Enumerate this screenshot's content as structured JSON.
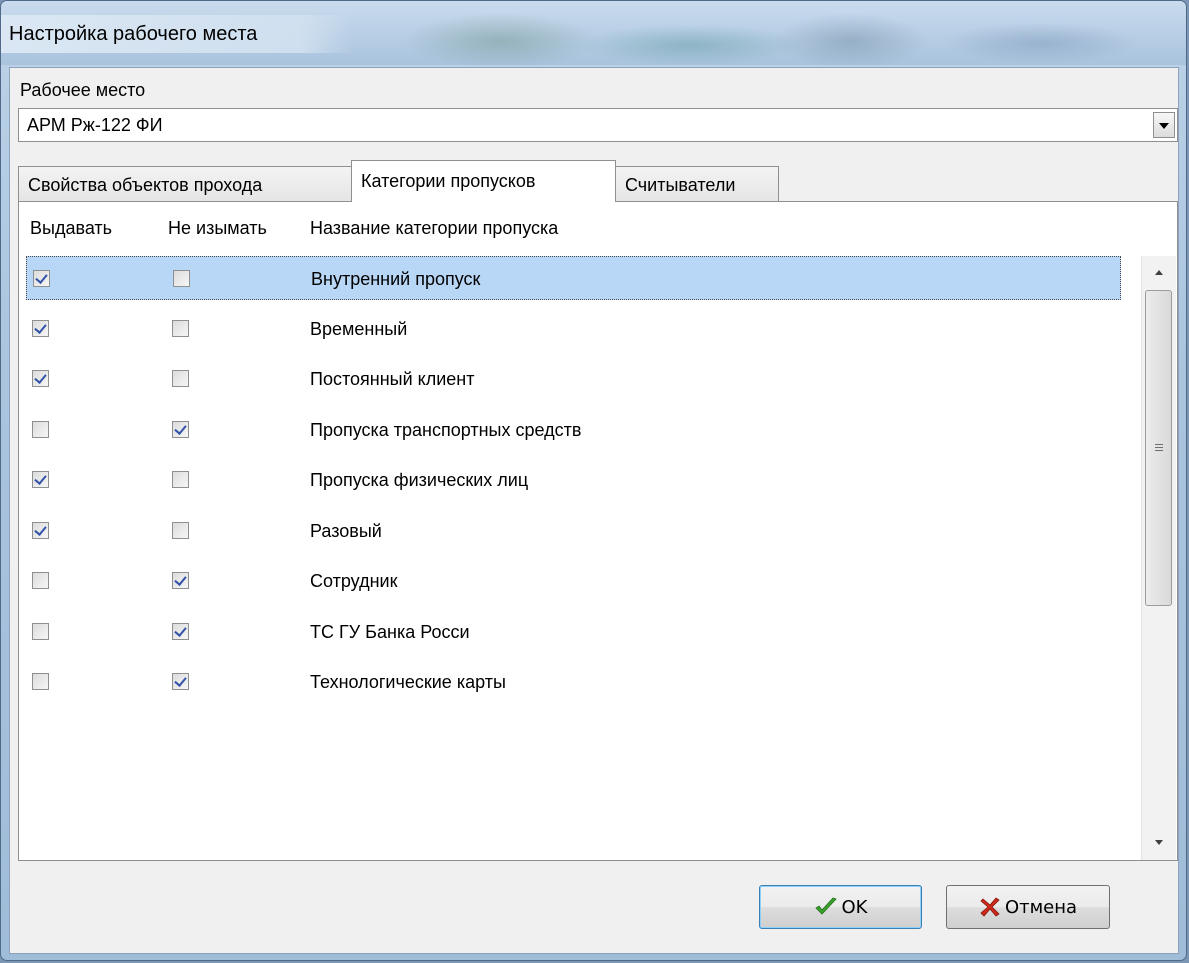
{
  "window": {
    "title": "Настройка рабочего места"
  },
  "workstation": {
    "label": "Рабочее место",
    "value": "АРМ Рж-122 ФИ"
  },
  "tabs": [
    {
      "label": "Свойства объектов прохода",
      "active": false
    },
    {
      "label": "Категории пропусков",
      "active": true
    },
    {
      "label": "Считыватели",
      "active": false
    }
  ],
  "columns": {
    "issue": "Выдавать",
    "no_withdraw": "Не изымать",
    "name": "Название категории пропуска"
  },
  "rows": [
    {
      "issue": true,
      "no_withdraw": false,
      "name": "Внутренний пропуск",
      "selected": true
    },
    {
      "issue": true,
      "no_withdraw": false,
      "name": "Временный",
      "selected": false
    },
    {
      "issue": true,
      "no_withdraw": false,
      "name": "Постоянный клиент",
      "selected": false
    },
    {
      "issue": false,
      "no_withdraw": true,
      "name": "Пропуска транспортных средств",
      "selected": false
    },
    {
      "issue": true,
      "no_withdraw": false,
      "name": "Пропуска физических лиц",
      "selected": false
    },
    {
      "issue": true,
      "no_withdraw": false,
      "name": "Разовый",
      "selected": false
    },
    {
      "issue": false,
      "no_withdraw": true,
      "name": "Сотрудник",
      "selected": false
    },
    {
      "issue": false,
      "no_withdraw": true,
      "name": "ТС ГУ Банка Росси",
      "selected": false
    },
    {
      "issue": false,
      "no_withdraw": true,
      "name": "Технологические карты",
      "selected": false
    }
  ],
  "buttons": {
    "ok": "OK",
    "cancel": "Отмена"
  },
  "colors": {
    "selection": "#b8d6f5",
    "check_mark": "#3253a8",
    "ok_icon": "#3aa52c",
    "cancel_icon": "#d22a1a"
  },
  "icons": {
    "ok": "check-icon",
    "cancel": "x-icon",
    "combo": "dropdown-arrow-icon"
  }
}
